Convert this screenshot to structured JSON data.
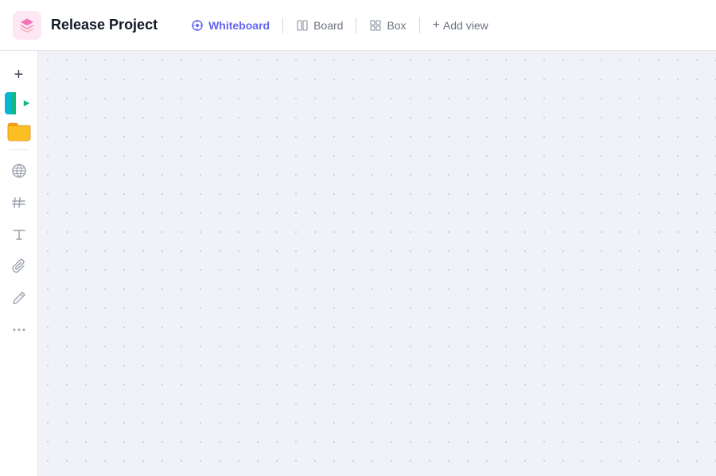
{
  "header": {
    "project_title": "Release Project",
    "tabs": [
      {
        "id": "whiteboard",
        "label": "Whiteboard",
        "active": true
      },
      {
        "id": "board",
        "label": "Board",
        "active": false
      },
      {
        "id": "box",
        "label": "Box",
        "active": false
      }
    ],
    "add_view_label": "Add view"
  },
  "sidebar": {
    "items": [
      {
        "id": "add",
        "icon": "+",
        "label": "Add"
      },
      {
        "id": "globe",
        "icon": "globe",
        "label": "Globe"
      },
      {
        "id": "hash",
        "icon": "#",
        "label": "Hash"
      },
      {
        "id": "text",
        "icon": "T",
        "label": "Text"
      },
      {
        "id": "attach",
        "icon": "attach",
        "label": "Attach"
      },
      {
        "id": "draw",
        "icon": "draw",
        "label": "Draw"
      },
      {
        "id": "more",
        "icon": "...",
        "label": "More"
      }
    ]
  },
  "canvas": {
    "background_color": "#f0f2f7",
    "dot_color": "#c5c8d4"
  }
}
